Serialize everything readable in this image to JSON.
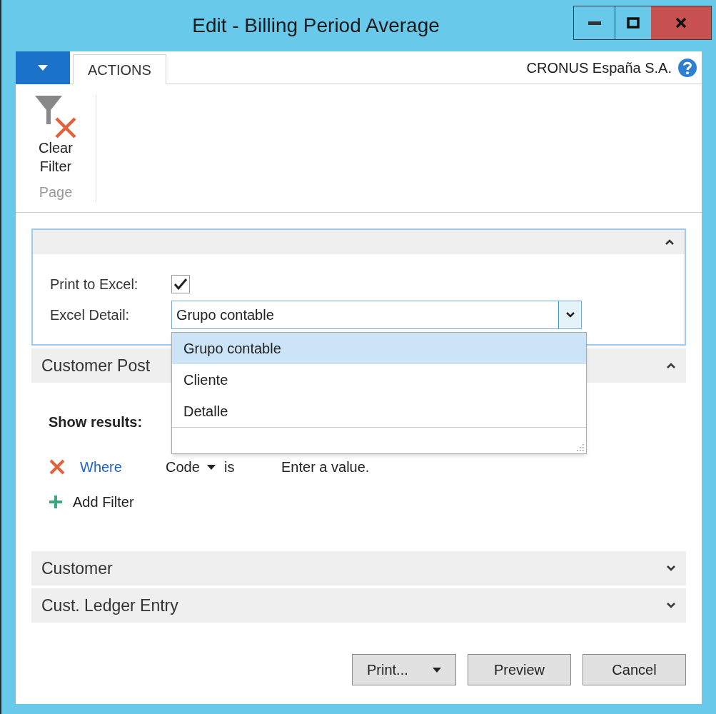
{
  "window": {
    "title": "Edit - Billing Period Average"
  },
  "ribbon": {
    "tabs": [
      {
        "label": "ACTIONS",
        "selected": true
      }
    ],
    "company": "CRONUS España S.A.",
    "groups": [
      {
        "label": "Page",
        "actions": [
          {
            "label": "Clear Filter"
          }
        ]
      }
    ]
  },
  "options": {
    "expanded": true,
    "fields": [
      {
        "kind": "checkbox",
        "label": "Print to Excel:",
        "checked": true
      },
      {
        "kind": "dropdown",
        "label": "Excel Detail:",
        "value": "Grupo contable",
        "open": true,
        "options": [
          {
            "label": "Grupo contable",
            "selected": true
          },
          {
            "label": "Cliente",
            "selected": false
          },
          {
            "label": "Detalle",
            "selected": false
          }
        ]
      }
    ]
  },
  "sections": [
    {
      "title": "Customer Post",
      "expanded": true,
      "show_results": "Show results:",
      "filters": [
        {
          "conjunction": "Where",
          "field": "Code",
          "operator": "is",
          "value": "Enter a value."
        }
      ],
      "add_filter": "Add Filter"
    },
    {
      "title": "Customer",
      "expanded": false
    },
    {
      "title": "Cust. Ledger Entry",
      "expanded": false
    }
  ],
  "buttons": [
    {
      "label": "Print...",
      "kind": "split"
    },
    {
      "label": "Preview",
      "kind": "plain"
    },
    {
      "label": "Cancel",
      "kind": "plain"
    }
  ]
}
